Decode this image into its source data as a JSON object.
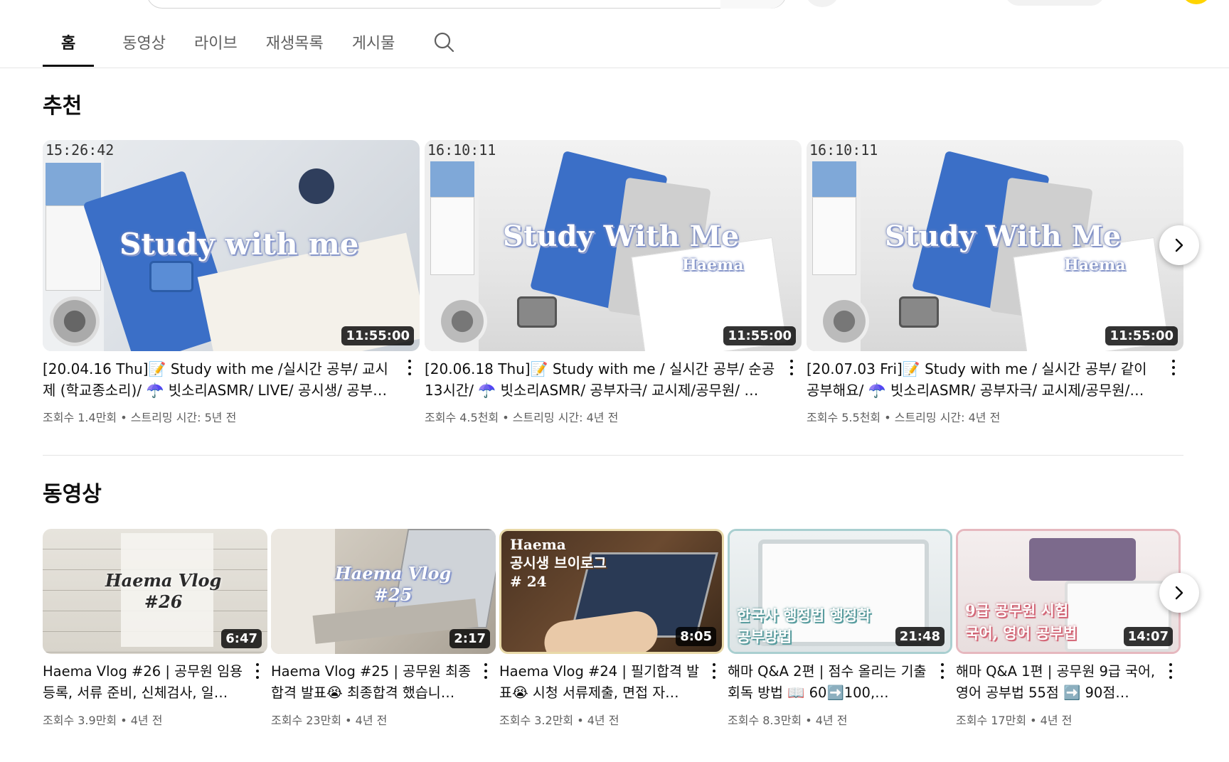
{
  "tabs": [
    "홈",
    "동영상",
    "라이브",
    "재생목록",
    "게시물"
  ],
  "sections": {
    "recommended": "추천",
    "videos": "동영상"
  },
  "recommended": [
    {
      "title": "[20.04.16 Thu]📝 Study with me /실시간 공부/ 교시제 (학교종소리)/ ☂️ 빗소리ASMR/ LIVE/ 공시생/ 공부방…",
      "meta": "조회수 1.4만회 • 스트리밍 시간: 5년 전",
      "duration": "11:55:00",
      "clock": "15:26:42",
      "overlay": "Study with me",
      "overlay2": ""
    },
    {
      "title": "[20.06.18 Thu]📝 Study with me / 실시간 공부/ 순공 13시간/ ☂️ 빗소리ASMR/ 공부자극/ 교시제/공무원/ …",
      "meta": "조회수 4.5천회 • 스트리밍 시간: 4년 전",
      "duration": "11:55:00",
      "clock": "16:10:11",
      "overlay": "Study With Me",
      "overlay2": "Haema"
    },
    {
      "title": "[20.07.03 Fri]📝 Study with me / 실시간 공부/ 같이 공부해요/ ☂️ 빗소리ASMR/ 공부자극/ 교시제/공무원/ 수…",
      "meta": "조회수 5.5천회 • 스트리밍 시간: 4년 전",
      "duration": "11:55:00",
      "clock": "16:10:11",
      "overlay": "Study With Me",
      "overlay2": "Haema"
    }
  ],
  "videos": [
    {
      "title": "Haema Vlog #26 | 공무원 임용 등록, 서류 준비, 신체검사, 일…",
      "meta": "조회수 3.9만회 • 4년 전",
      "duration": "6:47",
      "overlay": "Haema Vlog\n#26"
    },
    {
      "title": "Haema Vlog #25 | 공무원 최종 합격 발표😭 최종합격 했습니…",
      "meta": "조회수 23만회 • 4년 전",
      "duration": "2:17",
      "overlay": "Haema Vlog\n#25"
    },
    {
      "title": "Haema Vlog #24 | 필기합격 발표😭 시청 서류제출, 면접 자…",
      "meta": "조회수 3.2만회 • 4년 전",
      "duration": "8:05",
      "overlay": "Haema\n공시생 브이로그\n# 24"
    },
    {
      "title": "해마 Q&A 2편 | 점수 올리는 기출회독 방법 📖 60➡️100,…",
      "meta": "조회수 8.3만회 • 4년 전",
      "duration": "21:48",
      "overlay": "한국사 행정법 행정학\n공부방법"
    },
    {
      "title": "해마 Q&A 1편 | 공무원 9급 국어, 영어 공부법 55점 ➡️ 90점…",
      "meta": "조회수 17만회 • 4년 전",
      "duration": "14:07",
      "overlay": "9급 공무원 시험\n국어, 영어 공부법"
    }
  ]
}
